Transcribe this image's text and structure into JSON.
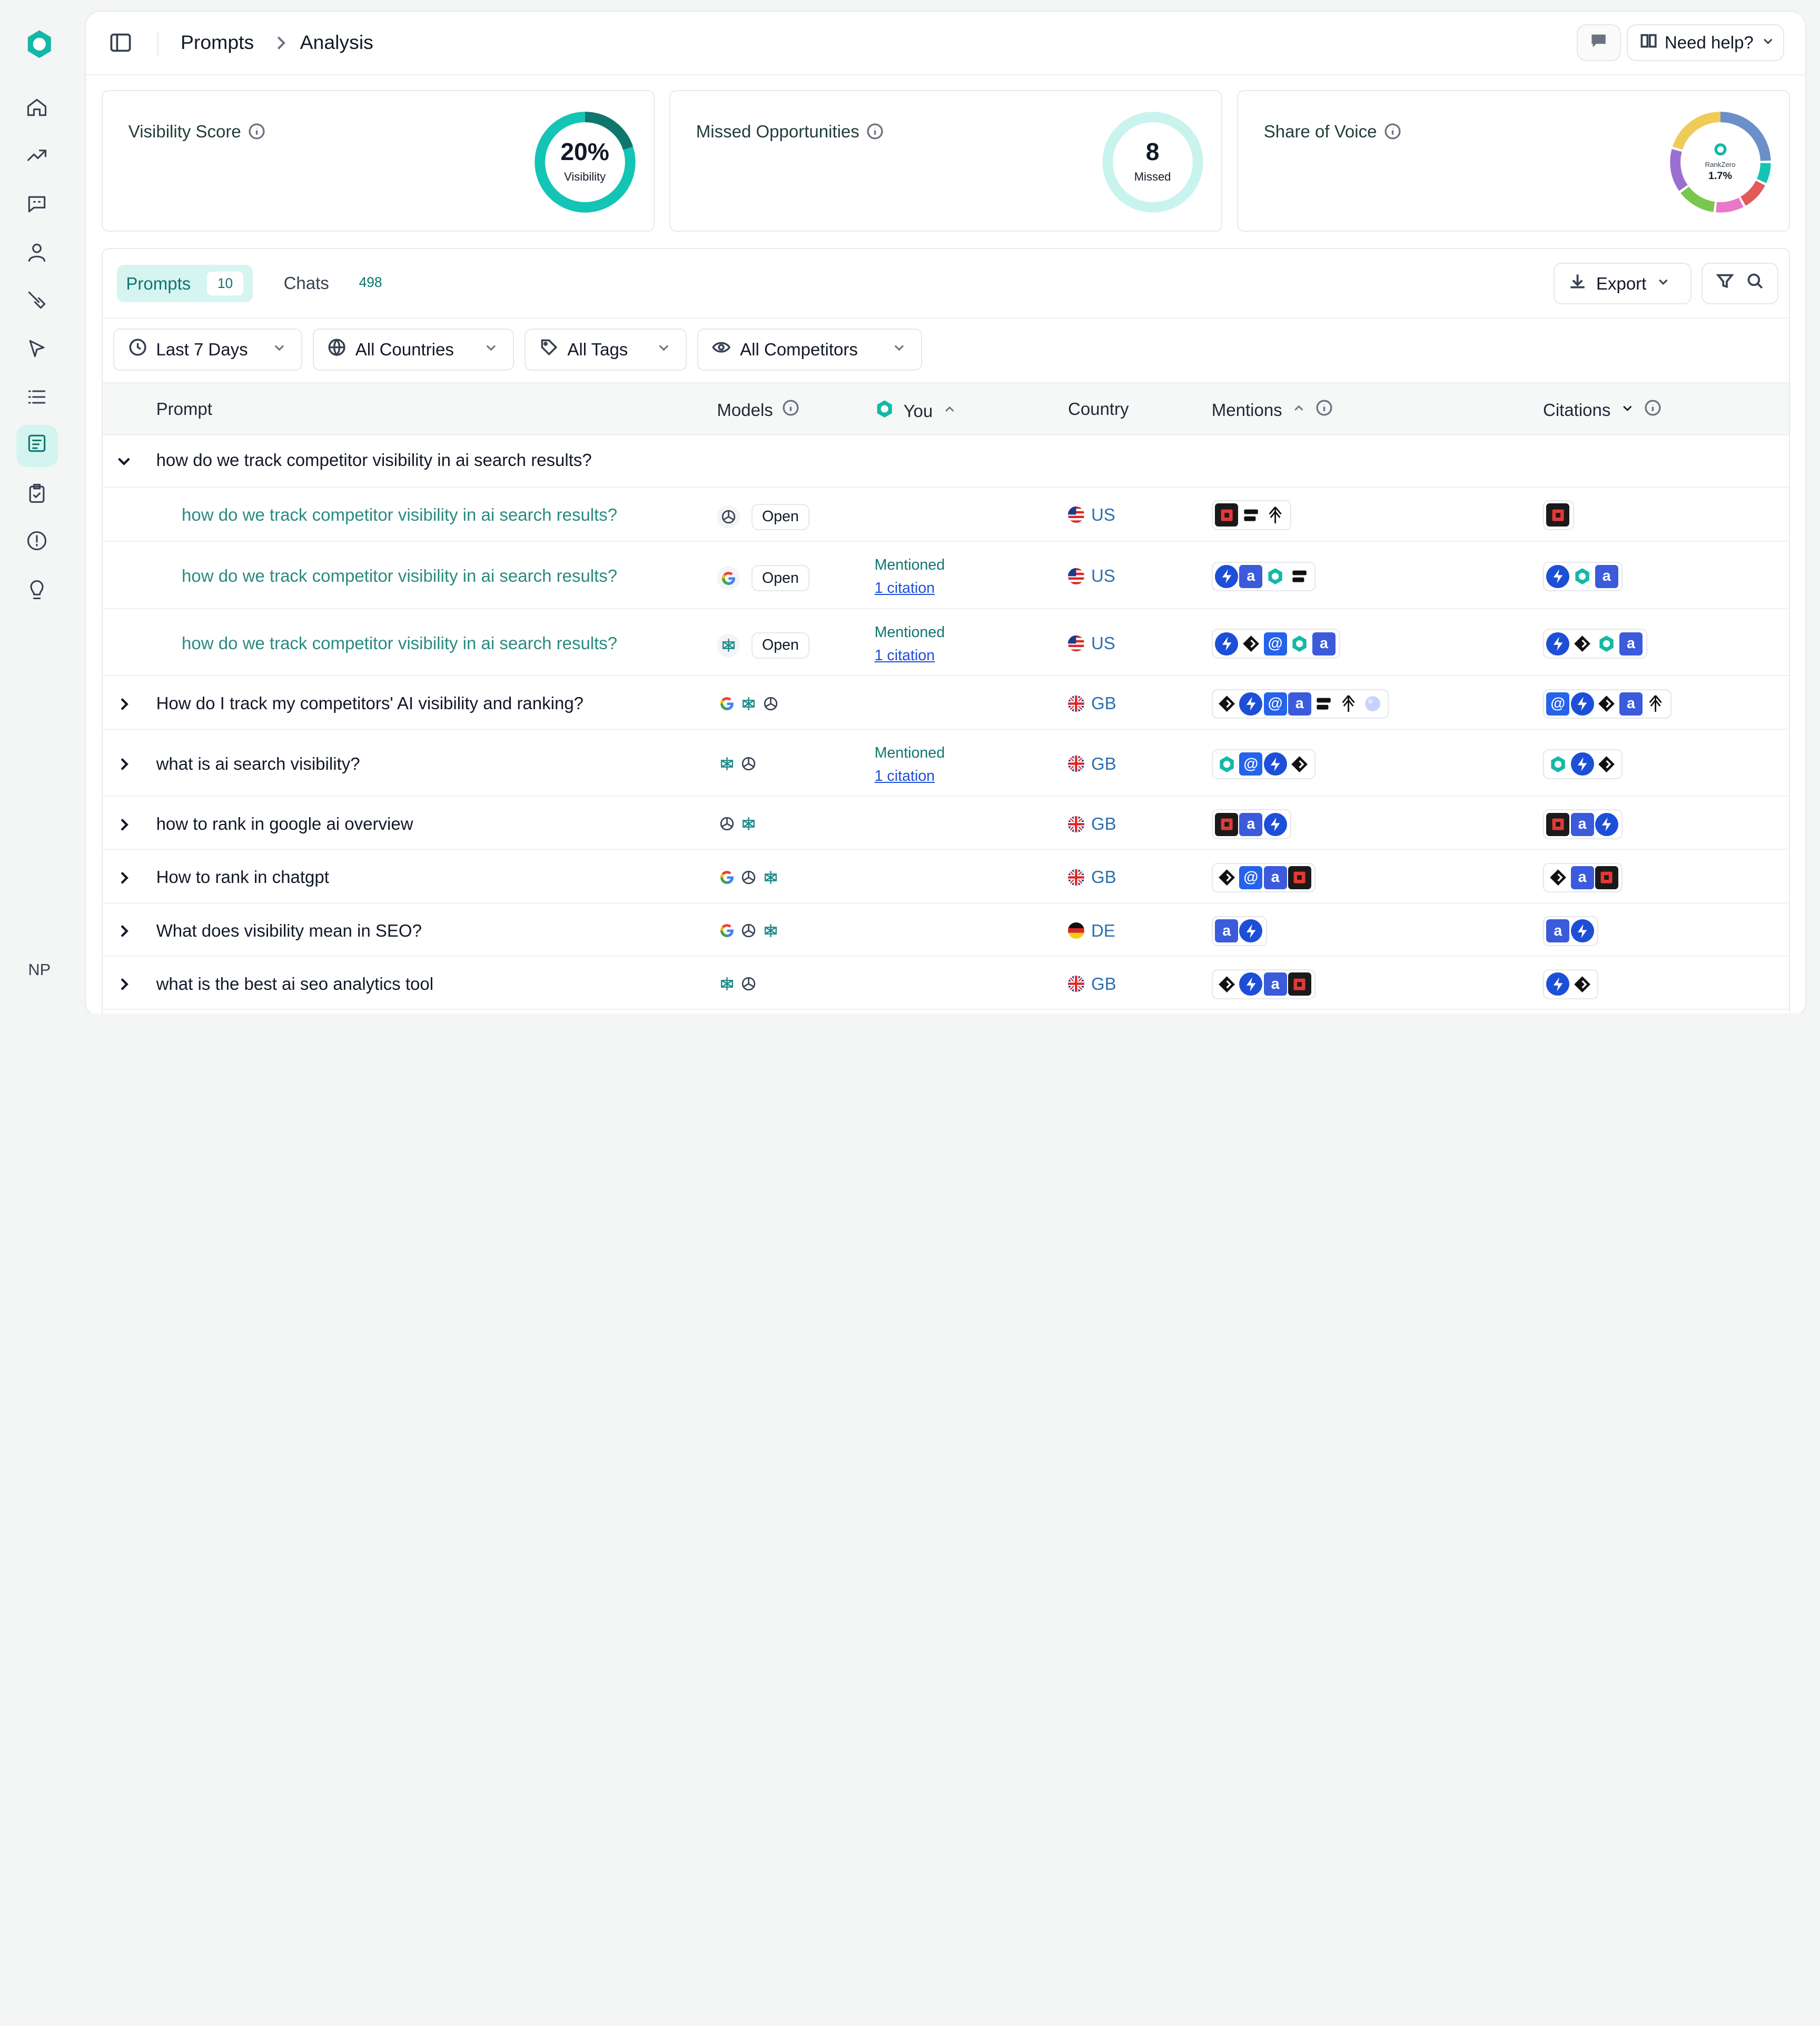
{
  "user": {
    "initials": "NP"
  },
  "breadcrumb": {
    "parent": "Prompts",
    "current": "Analysis"
  },
  "help": {
    "label": "Need help?"
  },
  "cards": {
    "visibility": {
      "title": "Visibility Score",
      "value": "20%",
      "sub": "Visibility",
      "percent": 20
    },
    "missed": {
      "title": "Missed Opportunities",
      "value": "8",
      "sub": "Missed"
    },
    "sov": {
      "title": "Share of Voice",
      "brand": "RankZero",
      "value": "1.7%"
    }
  },
  "tabs": {
    "prompts_label": "Prompts",
    "prompts_count": "10",
    "chats_label": "Chats",
    "chats_count": "498"
  },
  "export_label": "Export",
  "filters": {
    "date": "Last 7 Days",
    "countries": "All Countries",
    "tags": "All Tags",
    "competitors": "All Competitors"
  },
  "columns": {
    "prompt": "Prompt",
    "models": "Models",
    "you": "You",
    "country": "Country",
    "mentions": "Mentions",
    "citations": "Citations"
  },
  "open_label": "Open",
  "you_values": {
    "mentioned": "Mentioned",
    "citation": "1 citation"
  },
  "colors": {
    "accent": "#14b8a6",
    "accent_dark": "#0f766e",
    "link": "#1d4ed8"
  },
  "rows": [
    {
      "prompt": "how do we track competitor visibility in ai search results?",
      "country": "US",
      "expanded": true,
      "children": [
        {
          "prompt": "how do we track competitor visibility in ai search results?",
          "model": "chatgpt-icon",
          "country": "US",
          "you": "",
          "mentions": [
            "red-square-icon",
            "black-bars-icon",
            "arrow-tree-icon"
          ],
          "citations": [
            "red-square-icon"
          ]
        },
        {
          "prompt": "how do we track competitor visibility in ai search results?",
          "model": "google-icon",
          "country": "US",
          "you": "Mentioned",
          "mentions": [
            "blue-bolt-icon",
            "blue-a-icon",
            "teal-ring-icon",
            "black-bars-icon"
          ],
          "citations": [
            "blue-bolt-icon",
            "teal-ring-icon",
            "blue-a-icon"
          ]
        },
        {
          "prompt": "how do we track competitor visibility in ai search results?",
          "model": "perplexity-icon",
          "country": "US",
          "you": "Mentioned",
          "mentions": [
            "blue-bolt-icon",
            "black-diamond-icon",
            "blue-at-icon",
            "teal-ring-icon",
            "blue-a-icon"
          ],
          "citations": [
            "blue-bolt-icon",
            "black-diamond-icon",
            "teal-ring-icon",
            "blue-a-icon"
          ]
        }
      ]
    },
    {
      "prompt": "How do I track my competitors' AI visibility and ranking?",
      "models": [
        "google-icon",
        "perplexity-icon",
        "chatgpt-icon"
      ],
      "country": "GB",
      "you": "",
      "mentions": [
        "black-diamond-icon",
        "blue-bolt-icon",
        "blue-at-icon",
        "blue-a-icon",
        "black-bars-icon",
        "arrow-tree-icon",
        "globe-grey-icon"
      ],
      "citations": [
        "blue-at-icon",
        "blue-bolt-icon",
        "black-diamond-icon",
        "blue-a-icon",
        "arrow-tree-icon"
      ]
    },
    {
      "prompt": "what is ai search visibility?",
      "models": [
        "perplexity-icon",
        "chatgpt-icon"
      ],
      "country": "GB",
      "you": "Mentioned",
      "mentions": [
        "teal-ring-icon",
        "blue-at-icon",
        "blue-bolt-icon",
        "black-diamond-icon"
      ],
      "citations": [
        "teal-ring-icon",
        "blue-bolt-icon",
        "black-diamond-icon"
      ]
    },
    {
      "prompt": "how to rank in google ai overview",
      "models": [
        "chatgpt-icon",
        "perplexity-icon"
      ],
      "country": "GB",
      "you": "",
      "mentions": [
        "red-square-icon",
        "blue-a-icon",
        "blue-bolt-icon"
      ],
      "citations": [
        "red-square-icon",
        "blue-a-icon",
        "blue-bolt-icon"
      ]
    },
    {
      "prompt": "How to rank in chatgpt",
      "models": [
        "google-icon",
        "chatgpt-icon",
        "perplexity-icon"
      ],
      "country": "GB",
      "you": "",
      "mentions": [
        "black-diamond-icon",
        "blue-at-icon",
        "blue-a-icon",
        "red-square-icon"
      ],
      "citations": [
        "black-diamond-icon",
        "blue-a-icon",
        "red-square-icon"
      ]
    },
    {
      "prompt": "What does visibility mean in SEO?",
      "models": [
        "google-icon",
        "chatgpt-icon",
        "perplexity-icon"
      ],
      "country": "DE",
      "you": "",
      "mentions": [
        "blue-a-icon",
        "blue-bolt-icon"
      ],
      "citations": [
        "blue-a-icon",
        "blue-bolt-icon"
      ]
    },
    {
      "prompt": "what is the best ai seo analytics tool",
      "models": [
        "perplexity-icon",
        "chatgpt-icon"
      ],
      "country": "GB",
      "you": "",
      "mentions": [
        "black-diamond-icon",
        "blue-bolt-icon",
        "blue-a-icon",
        "red-square-icon"
      ],
      "citations": [
        "blue-bolt-icon",
        "black-diamond-icon"
      ]
    }
  ]
}
